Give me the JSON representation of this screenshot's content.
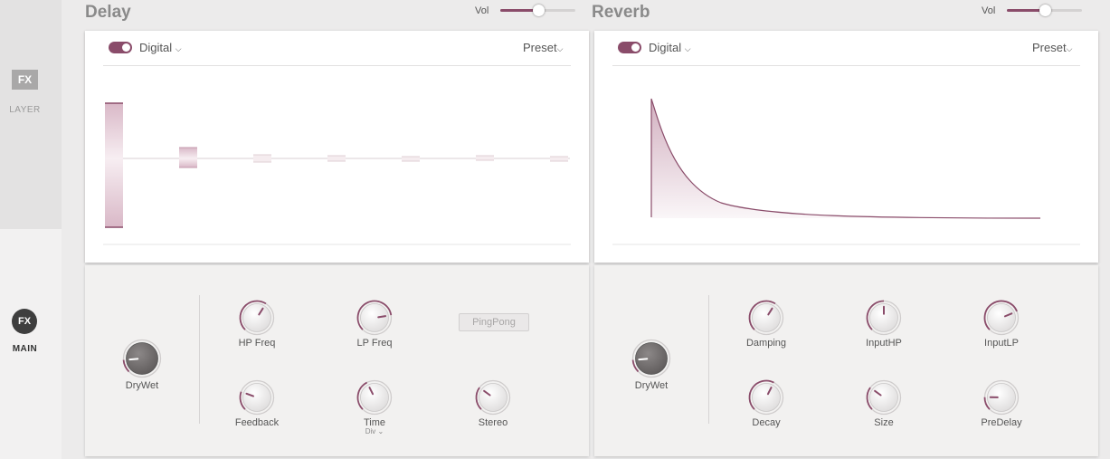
{
  "sidebar": {
    "layer_fx_label": "FX",
    "layer_label": "LAYER",
    "main_fx_label": "FX",
    "main_label": "MAIN"
  },
  "delay": {
    "title": "Delay",
    "vol_label": "Vol",
    "vol_level": 0.5,
    "mode": "Digital",
    "preset_label": "Preset",
    "drywet": {
      "label": "DryWet",
      "value": 0.15
    },
    "knobs": [
      {
        "id": "hp-freq",
        "label": "HP Freq",
        "value": 0.62
      },
      {
        "id": "lp-freq",
        "label": "LP Freq",
        "value": 0.8
      },
      {
        "id": "feedback",
        "label": "Feedback",
        "value": 0.24
      },
      {
        "id": "time",
        "label": "Time",
        "value": 0.4,
        "sub": "Div"
      },
      {
        "id": "stereo",
        "label": "Stereo",
        "value": 0.3
      }
    ],
    "pingpong_label": "PingPong"
  },
  "reverb": {
    "title": "Reverb",
    "vol_label": "Vol",
    "vol_level": 0.5,
    "mode": "Digital",
    "preset_label": "Preset",
    "drywet": {
      "label": "DryWet",
      "value": 0.15
    },
    "knobs": [
      {
        "id": "damping",
        "label": "Damping",
        "value": 0.62
      },
      {
        "id": "inputhp",
        "label": "InputHP",
        "value": 0.5
      },
      {
        "id": "inputlp",
        "label": "InputLP",
        "value": 0.75
      },
      {
        "id": "decay",
        "label": "Decay",
        "value": 0.6
      },
      {
        "id": "size",
        "label": "Size",
        "value": 0.3
      },
      {
        "id": "predelay",
        "label": "PreDelay",
        "value": 0.17
      }
    ]
  },
  "colors": {
    "accent": "#8a4c6a",
    "background": "#ecebeb",
    "panel": "#ffffff"
  }
}
